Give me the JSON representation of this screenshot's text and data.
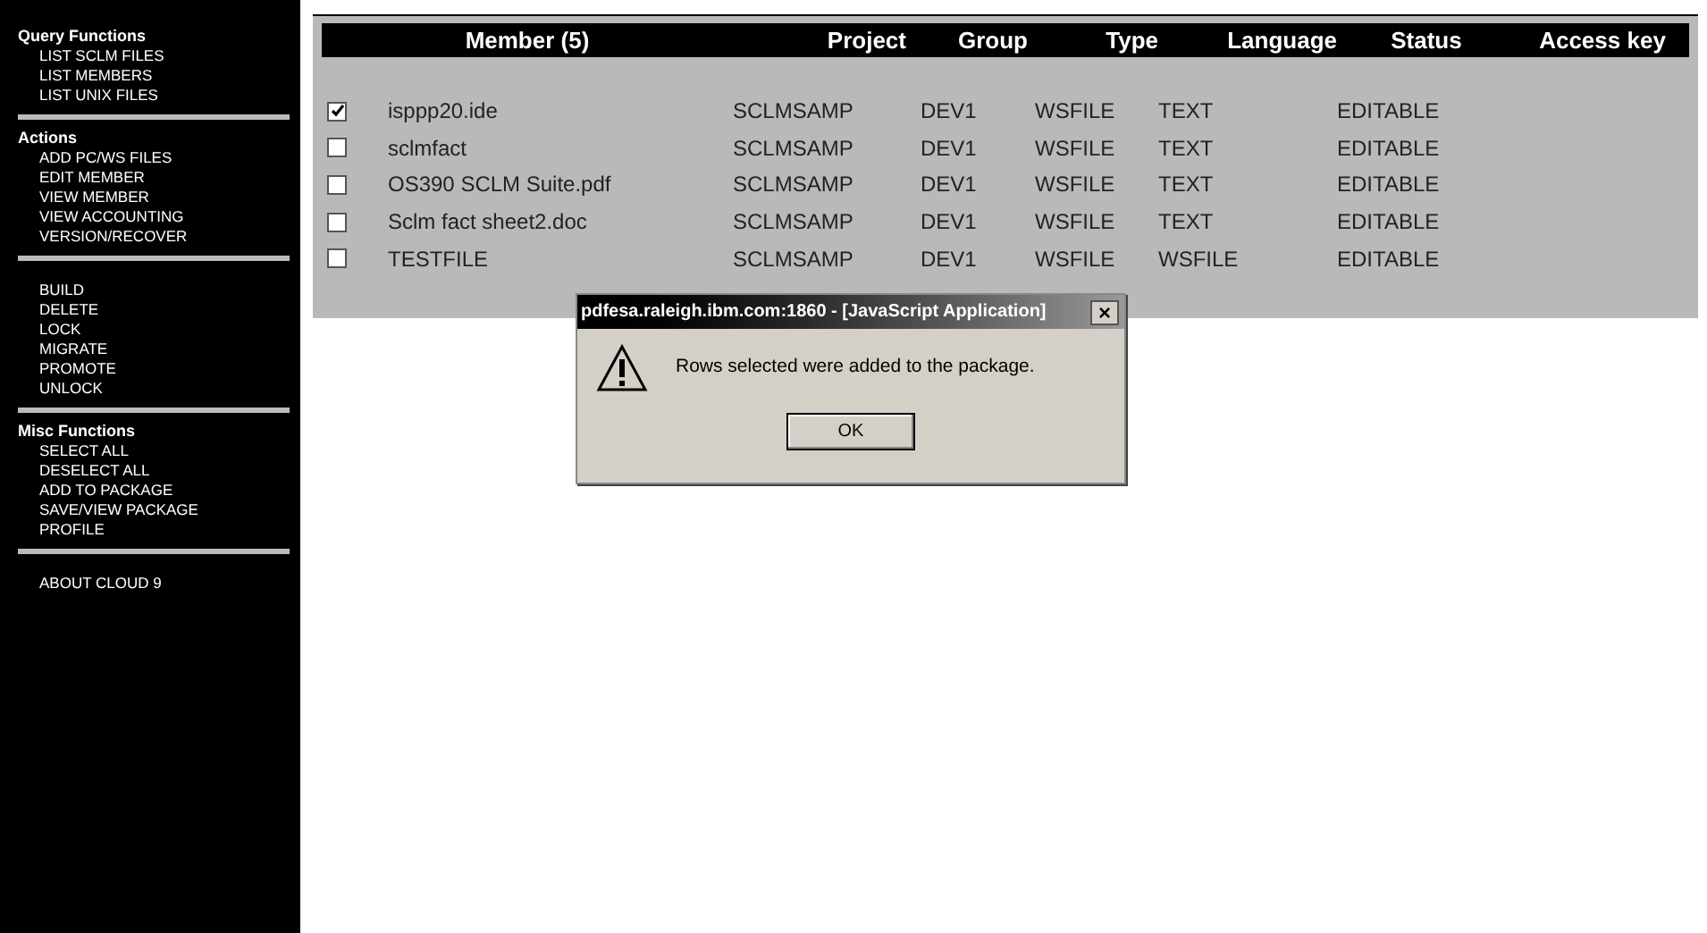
{
  "sidebar": {
    "sections": [
      {
        "heading": "Query Functions",
        "items": [
          "LIST SCLM FILES",
          "LIST MEMBERS",
          "LIST UNIX FILES"
        ]
      },
      {
        "heading": "Actions",
        "items": [
          "ADD PC/WS FILES",
          "EDIT MEMBER",
          "VIEW MEMBER",
          "VIEW ACCOUNTING",
          "VERSION/RECOVER"
        ]
      },
      {
        "items": [
          "BUILD",
          "DELETE",
          "LOCK",
          "MIGRATE",
          "PROMOTE",
          "UNLOCK"
        ]
      },
      {
        "heading": "Misc Functions",
        "items": [
          "SELECT ALL",
          "DESELECT ALL",
          "ADD TO PACKAGE",
          "SAVE/VIEW PACKAGE",
          "PROFILE"
        ]
      },
      {
        "items": [
          "ABOUT CLOUD 9"
        ]
      }
    ]
  },
  "table": {
    "columns": [
      "Member (5)",
      "Project",
      "Group",
      "Type",
      "Language",
      "Status",
      "Access key"
    ],
    "rows": [
      {
        "checked": true,
        "cells": [
          "isppp20.ide",
          "SCLMSAMP",
          "DEV1",
          "WSFILE",
          "TEXT",
          "EDITABLE"
        ]
      },
      {
        "checked": false,
        "cells": [
          "sclmfact",
          "SCLMSAMP",
          "DEV1",
          "WSFILE",
          "TEXT",
          "EDITABLE"
        ]
      },
      {
        "checked": false,
        "cells": [
          "OS390 SCLM Suite.pdf",
          "SCLMSAMP",
          "DEV1",
          "WSFILE",
          "TEXT",
          "EDITABLE"
        ]
      },
      {
        "checked": false,
        "cells": [
          "Sclm fact sheet2.doc",
          "SCLMSAMP",
          "DEV1",
          "WSFILE",
          "TEXT",
          "EDITABLE"
        ]
      },
      {
        "checked": false,
        "cells": [
          "TESTFILE",
          "SCLMSAMP",
          "DEV1",
          "WSFILE",
          "WSFILE",
          "EDITABLE"
        ]
      }
    ]
  },
  "dialog": {
    "title": "pdfesa.raleigh.ibm.com:1860 - [JavaScript Application]",
    "close": "×",
    "message": "Rows selected were added to the package.",
    "button": "OK"
  }
}
